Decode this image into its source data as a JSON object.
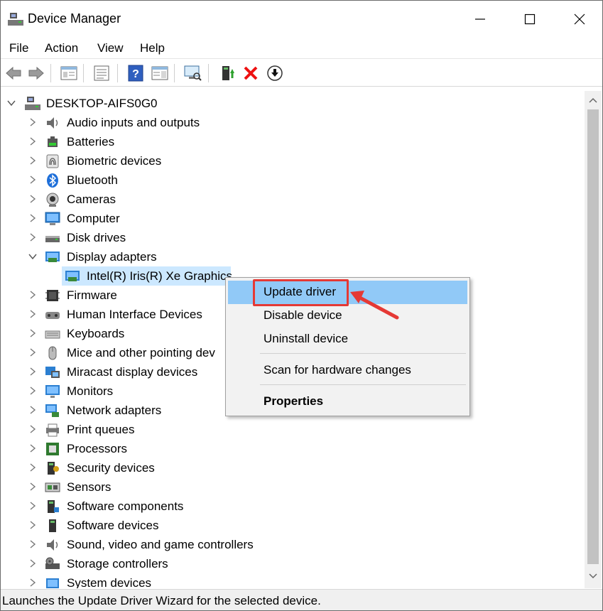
{
  "window": {
    "title": "Device Manager",
    "controls": {
      "minimize": "—",
      "maximize": "☐",
      "close": "✕"
    }
  },
  "menubar": {
    "items": [
      "File",
      "Action",
      "View",
      "Help"
    ]
  },
  "toolbar": {
    "buttons": [
      "back-icon",
      "forward-icon",
      "properties-panel-icon",
      "list-view-icon",
      "help-icon",
      "details-view-icon",
      "scan-hardware-icon",
      "update-driver-icon",
      "uninstall-icon",
      "download-icon"
    ]
  },
  "tree": {
    "root": "DESKTOP-AIFS0G0",
    "categories": [
      {
        "label": "Audio inputs and outputs",
        "icon": "speaker-icon"
      },
      {
        "label": "Batteries",
        "icon": "battery-icon"
      },
      {
        "label": "Biometric devices",
        "icon": "fingerprint-icon"
      },
      {
        "label": "Bluetooth",
        "icon": "bluetooth-icon"
      },
      {
        "label": "Cameras",
        "icon": "camera-icon"
      },
      {
        "label": "Computer",
        "icon": "computer-icon"
      },
      {
        "label": "Disk drives",
        "icon": "disk-icon"
      },
      {
        "label": "Display adapters",
        "icon": "display-adapter-icon",
        "expanded": true
      },
      {
        "label": "Firmware",
        "icon": "firmware-icon"
      },
      {
        "label": "Human Interface Devices",
        "icon": "hid-icon"
      },
      {
        "label": "Keyboards",
        "icon": "keyboard-icon"
      },
      {
        "label": "Mice and other pointing dev",
        "icon": "mouse-icon"
      },
      {
        "label": "Miracast display devices",
        "icon": "miracast-icon"
      },
      {
        "label": "Monitors",
        "icon": "monitor-icon"
      },
      {
        "label": "Network adapters",
        "icon": "network-icon"
      },
      {
        "label": "Print queues",
        "icon": "printer-icon"
      },
      {
        "label": "Processors",
        "icon": "processor-icon"
      },
      {
        "label": "Security devices",
        "icon": "security-icon"
      },
      {
        "label": "Sensors",
        "icon": "sensor-icon"
      },
      {
        "label": "Software components",
        "icon": "software-component-icon"
      },
      {
        "label": "Software devices",
        "icon": "software-device-icon"
      },
      {
        "label": "Sound, video and game controllers",
        "icon": "sound-icon"
      },
      {
        "label": "Storage controllers",
        "icon": "storage-icon"
      },
      {
        "label": "System devices",
        "icon": "system-icon"
      }
    ],
    "display_child": "Intel(R) Iris(R) Xe Graphics"
  },
  "context_menu": {
    "items": [
      "Update driver",
      "Disable device",
      "Uninstall device",
      "Scan for hardware changes",
      "Properties"
    ]
  },
  "statusbar": {
    "text": "Launches the Update Driver Wizard for the selected device."
  },
  "colors": {
    "selection": "#cce8ff",
    "menu_highlight": "#91c9f7",
    "callout": "#e53935"
  }
}
